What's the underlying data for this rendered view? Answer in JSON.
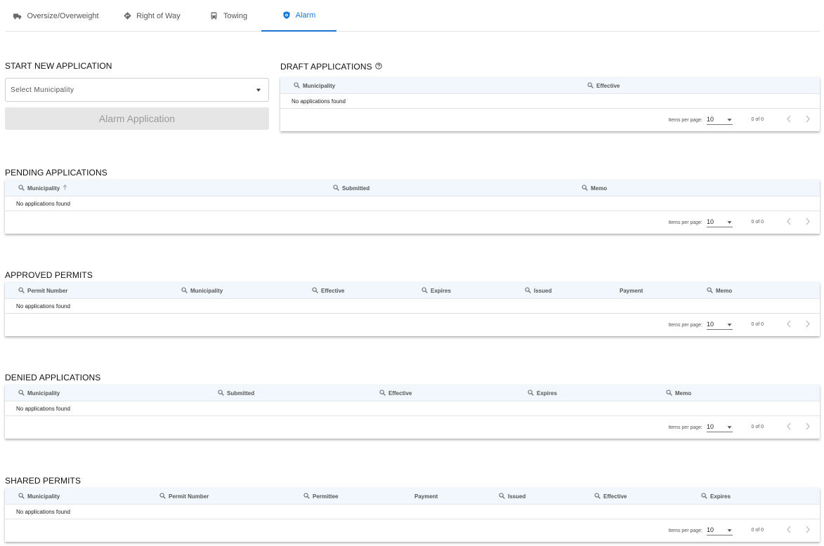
{
  "tabs": [
    {
      "label": "Oversize/Overweight",
      "icon": "truck-icon"
    },
    {
      "label": "Right of Way",
      "icon": "diamond-turn-icon"
    },
    {
      "label": "Towing",
      "icon": "bus-icon"
    },
    {
      "label": "Alarm",
      "icon": "shield-icon",
      "active": true
    }
  ],
  "start": {
    "title": "START NEW APPLICATION",
    "select_placeholder": "Select Municipality",
    "button_label": "Alarm Application"
  },
  "empty_text": "No applications found",
  "pager": {
    "items_per_page_label": "Items per page:",
    "page_size": "10",
    "range": "0 of 0"
  },
  "draft": {
    "title": "DRAFT APPLICATIONS",
    "columns": [
      "Municipality",
      "Effective"
    ]
  },
  "pending": {
    "title": "PENDING APPLICATIONS",
    "columns": [
      "Municipality",
      "Submitted",
      "Memo"
    ]
  },
  "approved": {
    "title": "APPROVED PERMITS",
    "columns": [
      "Permit Number",
      "Municipality",
      "Effective",
      "Expires",
      "Issued",
      "Payment",
      "Memo"
    ]
  },
  "denied": {
    "title": "DENIED APPLICATIONS",
    "columns": [
      "Municipality",
      "Submitted",
      "Effective",
      "Expires",
      "Memo"
    ]
  },
  "shared": {
    "title": "SHARED PERMITS",
    "columns": [
      "Municipality",
      "Permit Number",
      "Permittee",
      "Payment",
      "Issued",
      "Effective",
      "Expires"
    ]
  },
  "colors": {
    "accent": "#1976d2",
    "header_bg": "#f2f7fd",
    "disabled_bg": "#e6e6e6"
  }
}
